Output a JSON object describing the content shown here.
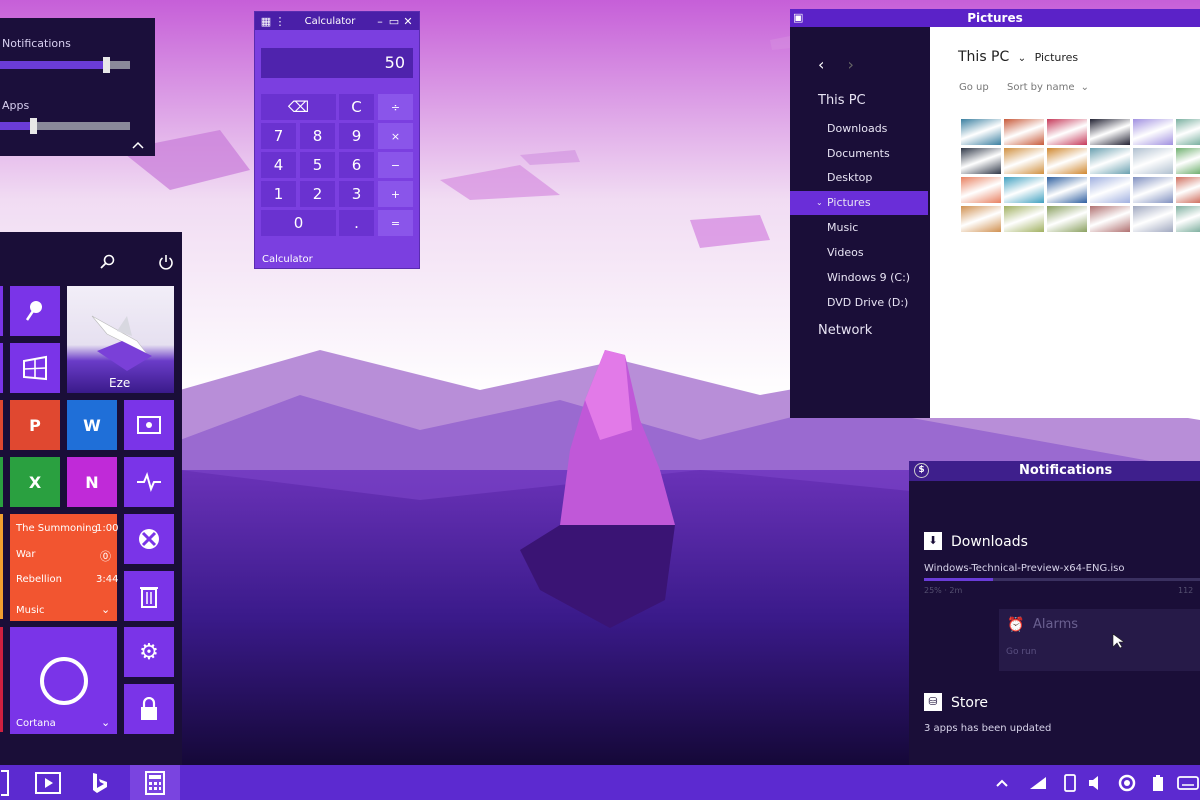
{
  "volume_popup": {
    "sliders": [
      {
        "label": "Notifications",
        "value": 0.82
      },
      {
        "label": "Apps",
        "value": 0.26
      }
    ]
  },
  "calculator": {
    "title": "Calculator",
    "display": "50",
    "footer": "Calculator",
    "keys": [
      [
        "⌫",
        "C",
        "÷"
      ],
      [
        "7",
        "8",
        "9",
        "×"
      ],
      [
        "4",
        "5",
        "6",
        "−"
      ],
      [
        "1",
        "2",
        "3",
        "+"
      ],
      [
        "0",
        ".",
        "="
      ]
    ]
  },
  "explorer": {
    "title": "Pictures",
    "breadcrumb_root": "This PC",
    "breadcrumb_current": "Pictures",
    "go_up": "Go up",
    "sort": "Sort by name",
    "nav": {
      "this_pc": "This PC",
      "items": [
        "Downloads",
        "Documents",
        "Desktop",
        "Pictures",
        "Music",
        "Videos",
        "Windows 9 (C:)",
        "DVD Drive (D:)"
      ],
      "selected": "Pictures",
      "network": "Network"
    },
    "thumbnail_colors": [
      [
        "#3a7fa0",
        "#c85a3a",
        "#c63a5a",
        "#222233",
        "#a090e0",
        "#7ab0a0"
      ],
      [
        "#303848",
        "#d09040",
        "#d08830",
        "#6aa0b0",
        "#b0c0d0",
        "#70b070"
      ],
      [
        "#e88060",
        "#40a0c0",
        "#3060a0",
        "#a0b0e0",
        "#8090c0",
        "#d07060"
      ],
      [
        "#d09050",
        "#a0b060",
        "#8aa060",
        "#b07070",
        "#a0a8c0",
        "#80b0a0"
      ]
    ]
  },
  "notifications": {
    "title": "Notifications",
    "downloads_title": "Downloads",
    "download_file": "Windows-Technical-Preview-x64-ENG.iso",
    "download_progress": 0.25,
    "download_meta_left": "25% · 2m",
    "download_meta_right": "112",
    "alarms_title": "Alarms",
    "alarms_text": "Go run",
    "store_title": "Store",
    "store_text": "3 apps has been updated"
  },
  "start_menu": {
    "user_tile": "Eze",
    "music_tile": {
      "rows": [
        {
          "title": "The Summoning",
          "time": "1:00"
        },
        {
          "title": "War",
          "time": ""
        },
        {
          "title": "Rebellion",
          "time": "3:44"
        }
      ],
      "label": "Music"
    },
    "cortana_label": "Cortana"
  },
  "colors": {
    "accent": "#7a34e8",
    "dark_panel": "#1a0e38",
    "taskbar": "#5c2ad0"
  }
}
